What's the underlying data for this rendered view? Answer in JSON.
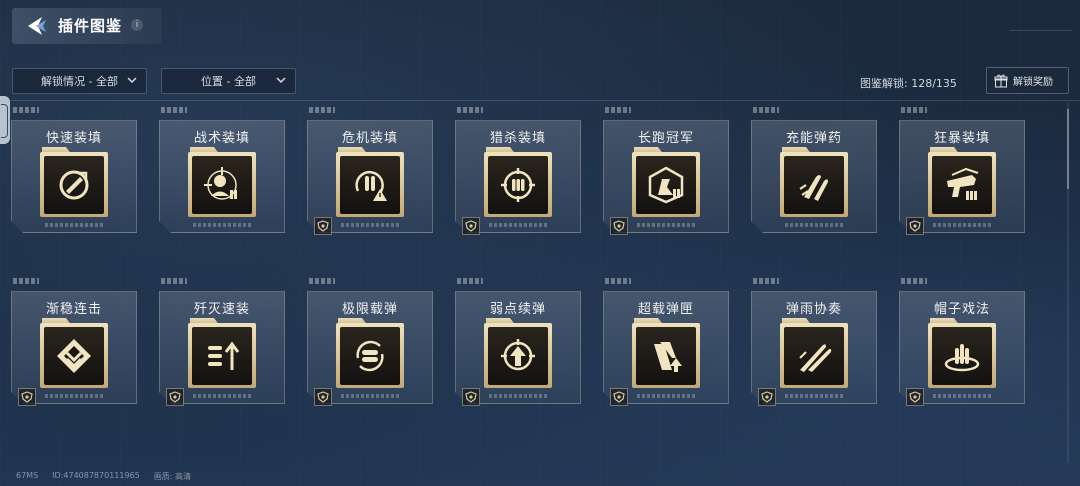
{
  "header": {
    "title": "插件图鉴",
    "info": "i"
  },
  "filters": {
    "unlock": "解锁情况 - 全部",
    "position": "位置 - 全部"
  },
  "progress": {
    "label": "图鉴解锁:",
    "value": "128/135"
  },
  "reward_button": {
    "label": "解锁奖励"
  },
  "plugins": [
    {
      "name": "快速装填",
      "icon": "rapid-reload-icon",
      "badge": false
    },
    {
      "name": "战术装填",
      "icon": "tactical-reload-icon",
      "badge": false
    },
    {
      "name": "危机装填",
      "icon": "crisis-reload-icon",
      "badge": true
    },
    {
      "name": "猎杀装填",
      "icon": "hunt-reload-icon",
      "badge": true
    },
    {
      "name": "长跑冠军",
      "icon": "marathon-champion-icon",
      "badge": true
    },
    {
      "name": "充能弹药",
      "icon": "charged-ammo-icon",
      "badge": false
    },
    {
      "name": "狂暴装填",
      "icon": "rampage-reload-icon",
      "badge": true
    },
    {
      "name": "渐稳连击",
      "icon": "steady-combo-icon",
      "badge": true
    },
    {
      "name": "歼灭速装",
      "icon": "annihilation-reload-icon",
      "badge": true
    },
    {
      "name": "极限载弹",
      "icon": "max-ammo-icon",
      "badge": true
    },
    {
      "name": "弱点续弹",
      "icon": "weakpoint-refill-icon",
      "badge": true
    },
    {
      "name": "超载弹匣",
      "icon": "overload-magazine-icon",
      "badge": true
    },
    {
      "name": "弹雨协奏",
      "icon": "bullet-rain-icon",
      "badge": true
    },
    {
      "name": "帽子戏法",
      "icon": "hat-trick-icon",
      "badge": true
    }
  ],
  "footer": {
    "ms": "67MS",
    "id": "ID:474087870111965",
    "quality": "画质: 高清"
  },
  "colors": {
    "background": "#1c2a3d",
    "gold": "#e9dcb4",
    "icon_dark": "#1a1713"
  }
}
